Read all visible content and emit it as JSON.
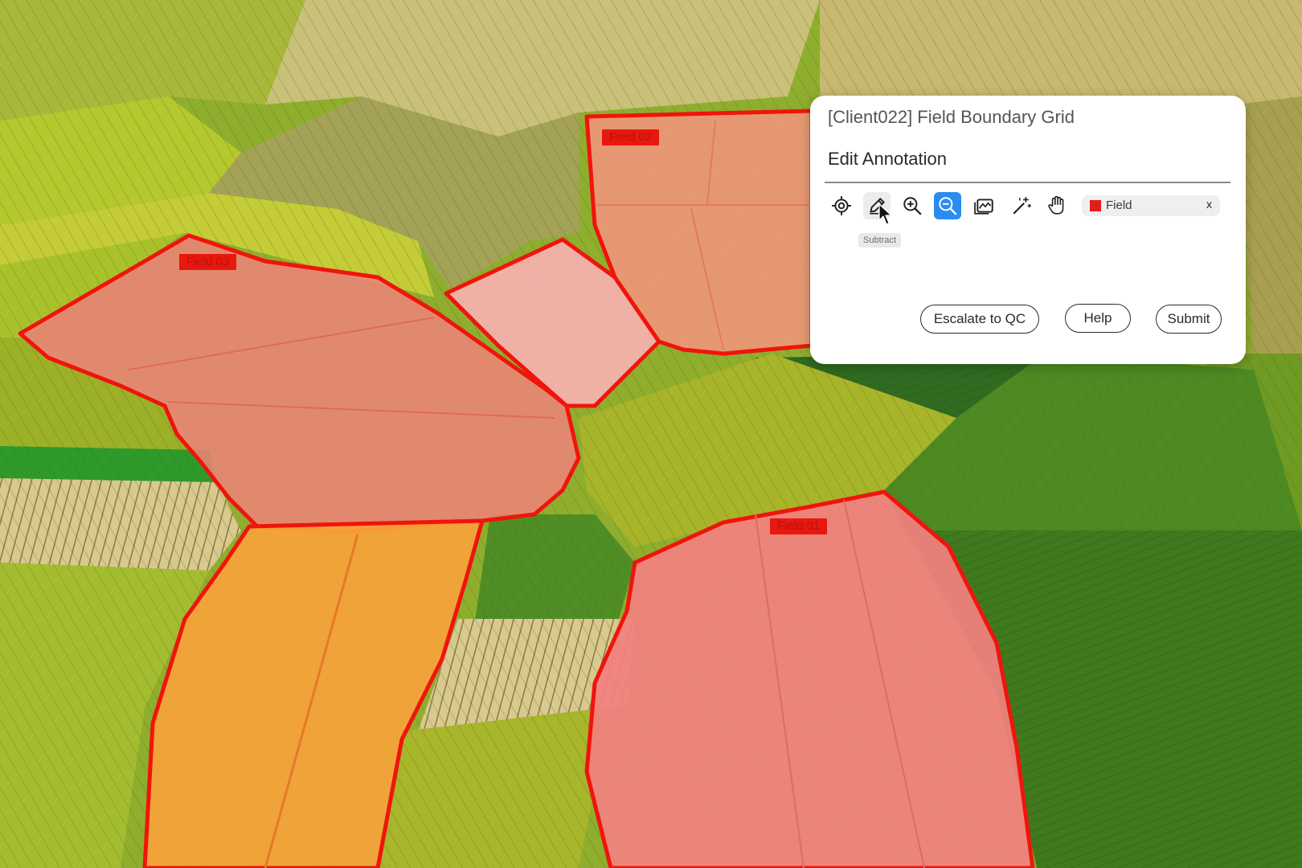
{
  "panel": {
    "project_title": "[Client022] Field Boundary Grid",
    "heading": "Edit Annotation",
    "tools": [
      {
        "name": "target",
        "icon": "crosshair-target-icon",
        "active": false
      },
      {
        "name": "subtract",
        "icon": "pencil-icon",
        "active": false,
        "hovered": true
      },
      {
        "name": "zoom-in",
        "icon": "zoom-in-icon",
        "active": false
      },
      {
        "name": "zoom-out",
        "icon": "zoom-out-icon",
        "active": true
      },
      {
        "name": "image",
        "icon": "image-chart-icon",
        "active": false
      },
      {
        "name": "magic-wand",
        "icon": "magic-wand-icon",
        "active": false
      },
      {
        "name": "pan",
        "icon": "hand-icon",
        "active": false
      }
    ],
    "tooltip": "Subtract",
    "label_chip": {
      "label": "Field",
      "color": "#e21d1d",
      "remove": "x"
    },
    "buttons": {
      "escalate": "Escalate to QC",
      "help": "Help",
      "submit": "Submit"
    }
  },
  "annotations": [
    {
      "label": "Field 01"
    },
    {
      "label": "Field 02"
    },
    {
      "label": "Field 03"
    }
  ],
  "colors": {
    "outline": "#f0140c",
    "tag": "#e8180e",
    "active_tool": "#2a8cf0"
  }
}
